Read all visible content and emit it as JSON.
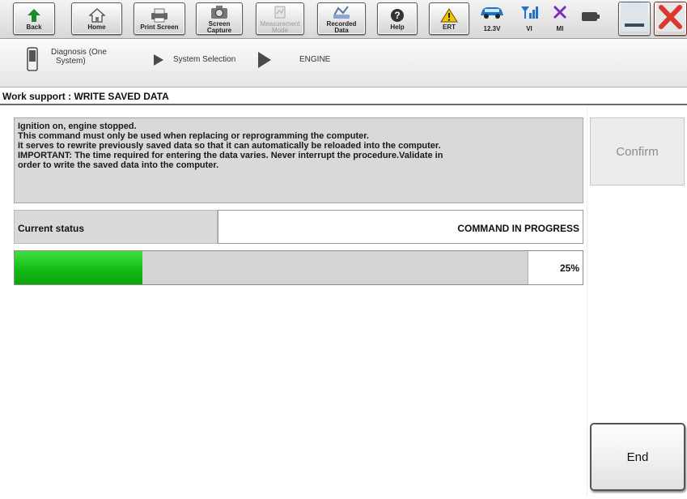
{
  "toolbar": {
    "back_label": "Back",
    "home_label": "Home",
    "print_screen_label": "Print Screen",
    "screen_capture_label_1": "Screen",
    "screen_capture_label_2": "Capture",
    "measurement_mode_label_1": "Measurement",
    "measurement_mode_label_2": "Mode",
    "recorded_data_label_1": "Recorded",
    "recorded_data_label_2": "Data",
    "help_label": "Help",
    "ert_label": "ERT",
    "battery_voltage": "12.3V",
    "vi_label": "VI",
    "mi_label": "MI",
    "icons": [
      "back-arrow-icon",
      "home-icon",
      "printer-icon",
      "camera-icon",
      "measurement-icon",
      "recorded-data-icon",
      "help-icon",
      "warning-icon",
      "car-icon",
      "signal-icon",
      "mi-x-icon",
      "battery-icon",
      "minimize-icon",
      "close-icon"
    ],
    "colors": {
      "back_green": "#1e8a2e",
      "warning_yellow": "#f2c400",
      "car_blue": "#1d74c8",
      "mi_purple": "#7a2fbf",
      "close_red": "#d83a2e"
    }
  },
  "breadcrumb": {
    "step1": "Diagnosis (One",
    "step1_line2": "System)",
    "step2": "System Selection",
    "step3": "ENGINE"
  },
  "work_support": {
    "title": "Work support : WRITE SAVED DATA"
  },
  "message": {
    "lines": [
      "Ignition on, engine stopped.",
      "This command must only be used when replacing or reprogramming the computer.",
      "It serves to rewrite previously saved data so that it can automatically be reloaded into the computer.",
      "IMPORTANT: The time required for entering the data varies. Never interrupt the procedure.Validate in",
      "order to write the saved data into the computer."
    ]
  },
  "confirm_label": "Confirm",
  "status": {
    "label": "Current status",
    "value": "COMMAND IN PROGRESS"
  },
  "progress": {
    "percent": 25,
    "percent_text": "25%"
  },
  "end_label": "End"
}
